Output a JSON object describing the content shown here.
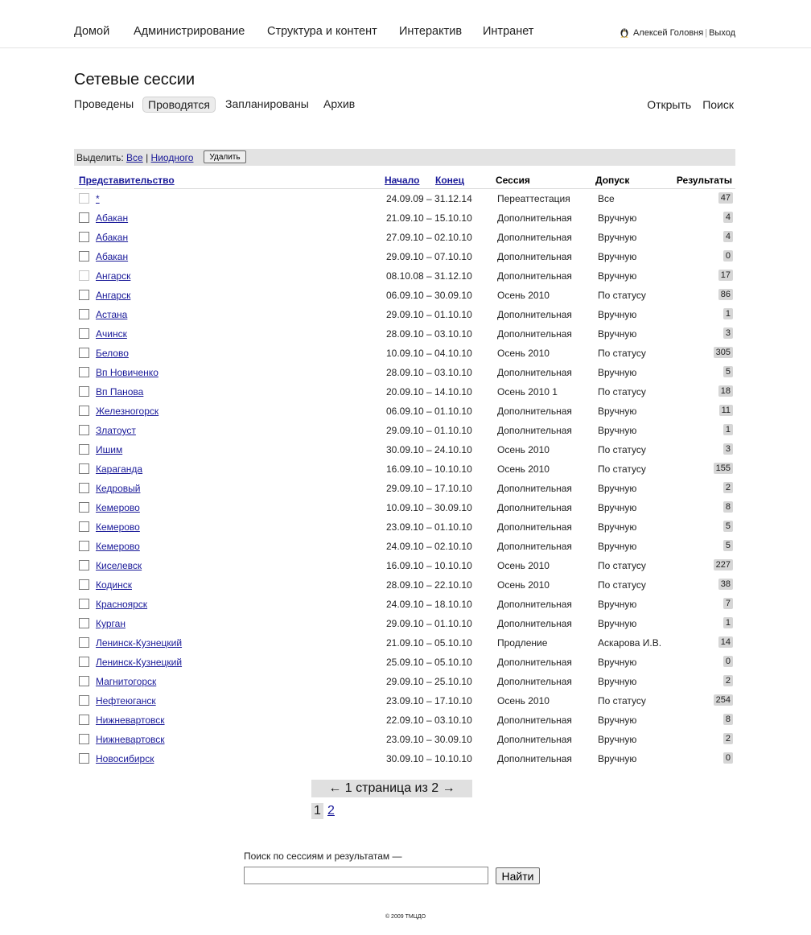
{
  "nav": {
    "items": [
      "Домой",
      "Администрирование",
      "Структура и контент",
      "Интерактив",
      "Интранет"
    ],
    "user_name": "Алексей Головня",
    "logout": "Выход",
    "separator": "|"
  },
  "page": {
    "title": "Сетевые сессии"
  },
  "tabs": [
    {
      "label": "Проведены",
      "active": false
    },
    {
      "label": "Проводятся",
      "active": true
    },
    {
      "label": "Запланированы",
      "active": false
    },
    {
      "label": "Архив",
      "active": false
    }
  ],
  "actions": {
    "open": "Открыть",
    "search": "Поиск"
  },
  "select_bar": {
    "label": "Выделить:",
    "all": "Все",
    "sep": "|",
    "none": "Ниодного",
    "delete_button": "Удалить"
  },
  "table": {
    "headers": {
      "office": "Представительство",
      "start": "Начало",
      "end": "Конец",
      "session": "Сессия",
      "admission": "Допуск",
      "results": "Результаты"
    },
    "rows": [
      {
        "office": "*",
        "dates": "24.09.09 – 31.12.14",
        "session": "Переаттестация",
        "admission": "Все",
        "results": "47",
        "dim": true
      },
      {
        "office": "Абакан",
        "dates": "21.09.10 – 15.10.10",
        "session": "Дополнительная",
        "admission": "Вручную",
        "results": "4",
        "dim": false
      },
      {
        "office": "Абакан",
        "dates": "27.09.10 – 02.10.10",
        "session": "Дополнительная",
        "admission": "Вручную",
        "results": "4",
        "dim": false
      },
      {
        "office": "Абакан",
        "dates": "29.09.10 – 07.10.10",
        "session": "Дополнительная",
        "admission": "Вручную",
        "results": "0",
        "dim": false
      },
      {
        "office": "Ангарск",
        "dates": "08.10.08 – 31.12.10",
        "session": "Дополнительная",
        "admission": "Вручную",
        "results": "17",
        "dim": true
      },
      {
        "office": "Ангарск",
        "dates": "06.09.10 – 30.09.10",
        "session": "Осень 2010",
        "admission": "По статусу",
        "results": "86",
        "dim": false
      },
      {
        "office": "Астана",
        "dates": "29.09.10 – 01.10.10",
        "session": "Дополнительная",
        "admission": "Вручную",
        "results": "1",
        "dim": false
      },
      {
        "office": "Ачинск",
        "dates": "28.09.10 – 03.10.10",
        "session": "Дополнительная",
        "admission": "Вручную",
        "results": "3",
        "dim": false
      },
      {
        "office": "Белово",
        "dates": "10.09.10 – 04.10.10",
        "session": "Осень 2010",
        "admission": "По статусу",
        "results": "305",
        "dim": false
      },
      {
        "office": "Вп Новиченко",
        "dates": "28.09.10 – 03.10.10",
        "session": "Дополнительная",
        "admission": "Вручную",
        "results": "5",
        "dim": false
      },
      {
        "office": "Вп Панова",
        "dates": "20.09.10 – 14.10.10",
        "session": "Осень 2010 1",
        "admission": "По статусу",
        "results": "18",
        "dim": false
      },
      {
        "office": "Железногорск",
        "dates": "06.09.10 – 01.10.10",
        "session": "Дополнительная",
        "admission": "Вручную",
        "results": "11",
        "dim": false
      },
      {
        "office": "Златоуст",
        "dates": "29.09.10 – 01.10.10",
        "session": "Дополнительная",
        "admission": "Вручную",
        "results": "1",
        "dim": false
      },
      {
        "office": "Ишим",
        "dates": "30.09.10 – 24.10.10",
        "session": "Осень 2010",
        "admission": "По статусу",
        "results": "3",
        "dim": false
      },
      {
        "office": "Караганда",
        "dates": "16.09.10 – 10.10.10",
        "session": "Осень 2010",
        "admission": "По статусу",
        "results": "155",
        "dim": false
      },
      {
        "office": "Кедровый",
        "dates": "29.09.10 – 17.10.10",
        "session": "Дополнительная",
        "admission": "Вручную",
        "results": "2",
        "dim": false
      },
      {
        "office": "Кемерово",
        "dates": "10.09.10 – 30.09.10",
        "session": "Дополнительная",
        "admission": "Вручную",
        "results": "8",
        "dim": false
      },
      {
        "office": "Кемерово",
        "dates": "23.09.10 – 01.10.10",
        "session": "Дополнительная",
        "admission": "Вручную",
        "results": "5",
        "dim": false
      },
      {
        "office": "Кемерово",
        "dates": "24.09.10 – 02.10.10",
        "session": "Дополнительная",
        "admission": "Вручную",
        "results": "5",
        "dim": false
      },
      {
        "office": "Киселевск",
        "dates": "16.09.10 – 10.10.10",
        "session": "Осень 2010",
        "admission": "По статусу",
        "results": "227",
        "dim": false
      },
      {
        "office": "Кодинск",
        "dates": "28.09.10 – 22.10.10",
        "session": "Осень 2010",
        "admission": "По статусу",
        "results": "38",
        "dim": false
      },
      {
        "office": "Красноярск",
        "dates": "24.09.10 – 18.10.10",
        "session": "Дополнительная",
        "admission": "Вручную",
        "results": "7",
        "dim": false
      },
      {
        "office": "Курган",
        "dates": "29.09.10 – 01.10.10",
        "session": "Дополнительная",
        "admission": "Вручную",
        "results": "1",
        "dim": false
      },
      {
        "office": "Ленинск-Кузнецкий",
        "dates": "21.09.10 – 05.10.10",
        "session": "Продление",
        "admission": "Аскарова И.В.",
        "results": "14",
        "dim": false
      },
      {
        "office": "Ленинск-Кузнецкий",
        "dates": "25.09.10 – 05.10.10",
        "session": "Дополнительная",
        "admission": "Вручную",
        "results": "0",
        "dim": false
      },
      {
        "office": "Магнитогорск",
        "dates": "29.09.10 – 25.10.10",
        "session": "Дополнительная",
        "admission": "Вручную",
        "results": "2",
        "dim": false
      },
      {
        "office": "Нефтеюганск",
        "dates": "23.09.10 – 17.10.10",
        "session": "Осень 2010",
        "admission": "По статусу",
        "results": "254",
        "dim": false
      },
      {
        "office": "Нижневартовск",
        "dates": "22.09.10 – 03.10.10",
        "session": "Дополнительная",
        "admission": "Вручную",
        "results": "8",
        "dim": false
      },
      {
        "office": "Нижневартовск",
        "dates": "23.09.10 – 30.09.10",
        "session": "Дополнительная",
        "admission": "Вручную",
        "results": "2",
        "dim": false
      },
      {
        "office": "Новосибирск",
        "dates": "30.09.10 – 10.10.10",
        "session": "Дополнительная",
        "admission": "Вручную",
        "results": "0",
        "dim": false
      }
    ]
  },
  "pagination": {
    "summary": "←  1 страница из 2  →",
    "current": "1",
    "other": "2"
  },
  "search": {
    "label": "Поиск по сессиям и результатам —",
    "button": "Найти",
    "value": ""
  },
  "footer": {
    "text": "© 2009 ТМЦДО"
  }
}
